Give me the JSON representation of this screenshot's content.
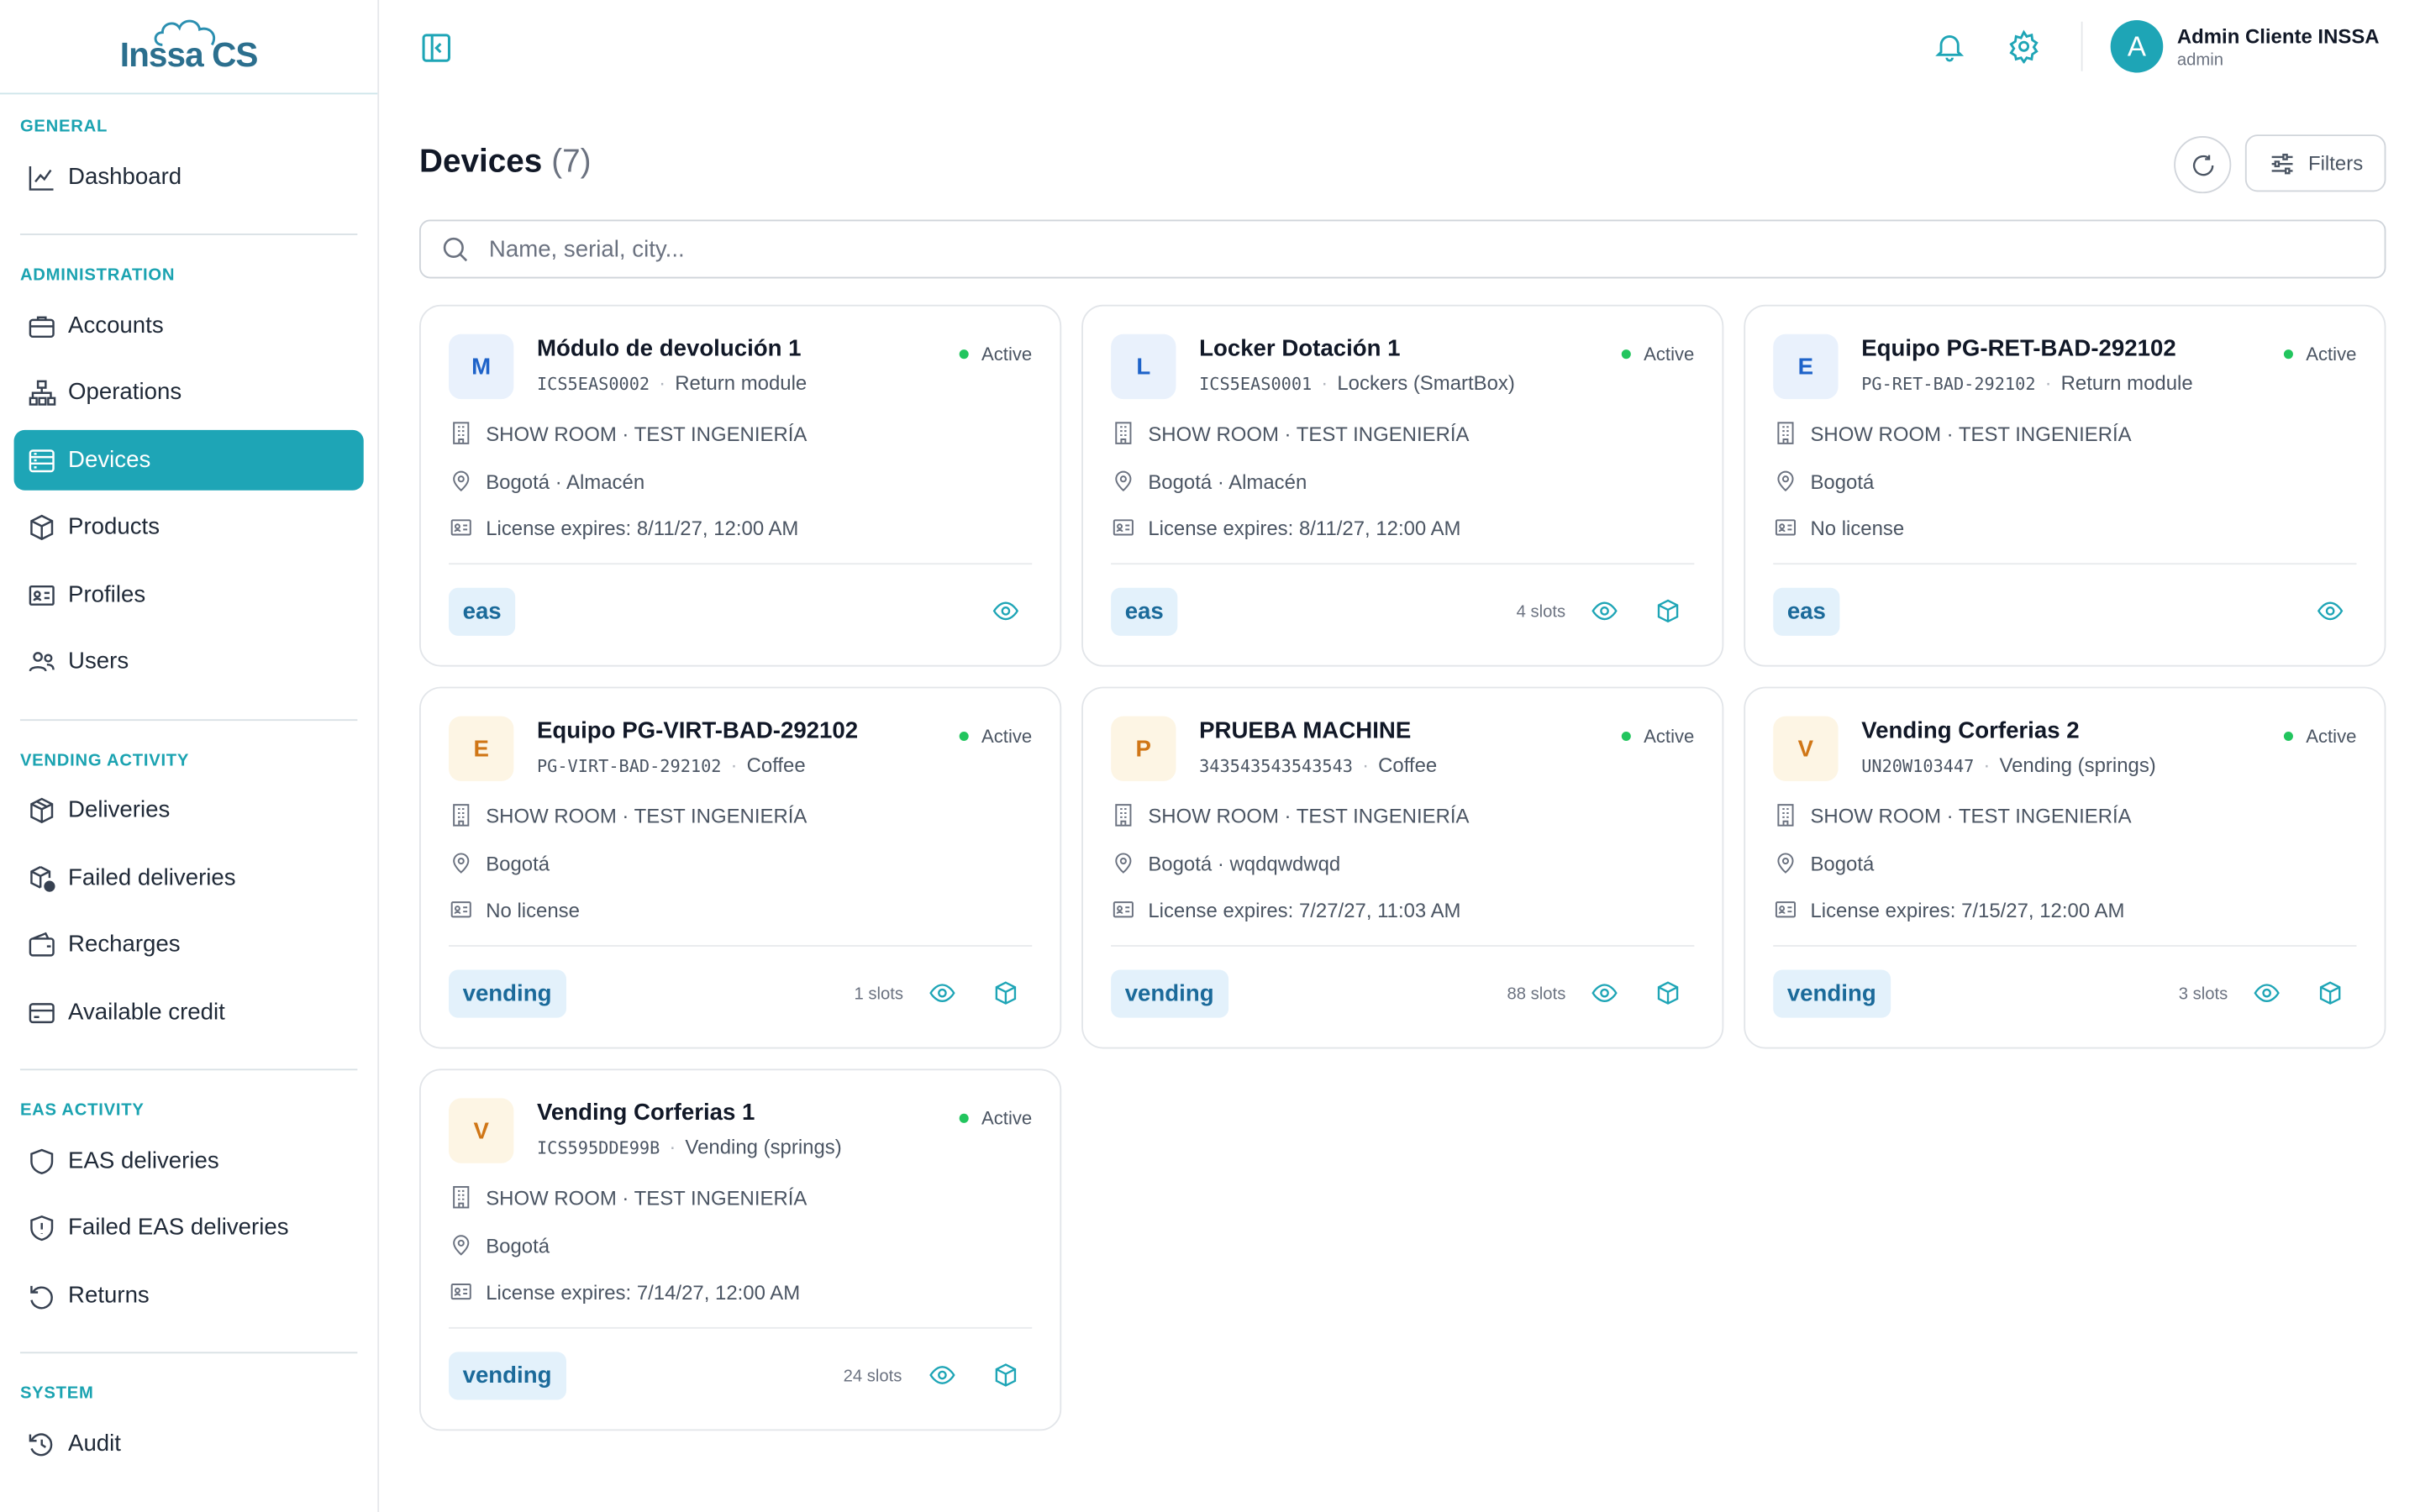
{
  "brand": {
    "name": "Inssa CS",
    "accent": "#1ea5b6"
  },
  "sidebar": {
    "sections": [
      {
        "title": "GENERAL",
        "items": [
          {
            "label": "Dashboard",
            "icon": "chart-line-icon"
          }
        ]
      },
      {
        "title": "ADMINISTRATION",
        "items": [
          {
            "label": "Accounts",
            "icon": "briefcase-icon"
          },
          {
            "label": "Operations",
            "icon": "hierarchy-icon"
          },
          {
            "label": "Devices",
            "icon": "server-icon",
            "active": true
          },
          {
            "label": "Products",
            "icon": "box-icon"
          },
          {
            "label": "Profiles",
            "icon": "id-card-icon"
          },
          {
            "label": "Users",
            "icon": "users-icon"
          }
        ]
      },
      {
        "title": "VENDING ACTIVITY",
        "items": [
          {
            "label": "Deliveries",
            "icon": "package-icon"
          },
          {
            "label": "Failed deliveries",
            "icon": "package-alert-icon"
          },
          {
            "label": "Recharges",
            "icon": "wallet-icon"
          },
          {
            "label": "Available credit",
            "icon": "credit-card-icon"
          }
        ]
      },
      {
        "title": "EAS ACTIVITY",
        "items": [
          {
            "label": "EAS deliveries",
            "icon": "shield-icon"
          },
          {
            "label": "Failed EAS deliveries",
            "icon": "shield-alert-icon"
          },
          {
            "label": "Returns",
            "icon": "undo-icon"
          }
        ]
      },
      {
        "title": "SYSTEM",
        "items": [
          {
            "label": "Audit",
            "icon": "history-icon"
          }
        ]
      }
    ]
  },
  "header": {
    "user_initial": "A",
    "user_name": "Admin Cliente INSSA",
    "user_role": "admin"
  },
  "page": {
    "title": "Devices",
    "count": "(7)",
    "filters_label": "Filters",
    "search_placeholder": "Name, serial, city..."
  },
  "devices": [
    {
      "initial": "M",
      "badge_color": "blue",
      "name": "Módulo de devolución 1",
      "serial": "ICS5EAS0002",
      "type": "Return module",
      "status": "Active",
      "org": "SHOW ROOM · TEST INGENIERÍA",
      "location": "Bogotá · Almacén",
      "license": "License expires: 8/11/27, 12:00 AM",
      "tag": "eas",
      "slots": ""
    },
    {
      "initial": "L",
      "badge_color": "blue",
      "name": "Locker Dotación 1",
      "serial": "ICS5EAS0001",
      "type": "Lockers (SmartBox)",
      "status": "Active",
      "org": "SHOW ROOM · TEST INGENIERÍA",
      "location": "Bogotá · Almacén",
      "license": "License expires: 8/11/27, 12:00 AM",
      "tag": "eas",
      "slots": "4 slots"
    },
    {
      "initial": "E",
      "badge_color": "blue",
      "name": "Equipo PG-RET-BAD-292102",
      "serial": "PG-RET-BAD-292102",
      "type": "Return module",
      "status": "Active",
      "org": "SHOW ROOM · TEST INGENIERÍA",
      "location": "Bogotá",
      "license": "No license",
      "tag": "eas",
      "slots": ""
    },
    {
      "initial": "E",
      "badge_color": "orange",
      "name": "Equipo PG-VIRT-BAD-292102",
      "serial": "PG-VIRT-BAD-292102",
      "type": "Coffee",
      "status": "Active",
      "org": "SHOW ROOM · TEST INGENIERÍA",
      "location": "Bogotá",
      "license": "No license",
      "tag": "vending",
      "slots": "1 slots"
    },
    {
      "initial": "P",
      "badge_color": "orange",
      "name": "PRUEBA MACHINE",
      "serial": "343543543543543",
      "type": "Coffee",
      "status": "Active",
      "org": "SHOW ROOM · TEST INGENIERÍA",
      "location": "Bogotá · wqdqwdwqd",
      "license": "License expires: 7/27/27, 11:03 AM",
      "tag": "vending",
      "slots": "88 slots"
    },
    {
      "initial": "V",
      "badge_color": "orange",
      "name": "Vending Corferias 2",
      "serial": "UN20W103447",
      "type": "Vending (springs)",
      "status": "Active",
      "org": "SHOW ROOM · TEST INGENIERÍA",
      "location": "Bogotá",
      "license": "License expires: 7/15/27, 12:00 AM",
      "tag": "vending",
      "slots": "3 slots"
    },
    {
      "initial": "V",
      "badge_color": "orange",
      "name": "Vending Corferias 1",
      "serial": "ICS595DDE99B",
      "type": "Vending (springs)",
      "status": "Active",
      "org": "SHOW ROOM · TEST INGENIERÍA",
      "location": "Bogotá",
      "license": "License expires: 7/14/27, 12:00 AM",
      "tag": "vending",
      "slots": "24 slots"
    }
  ]
}
